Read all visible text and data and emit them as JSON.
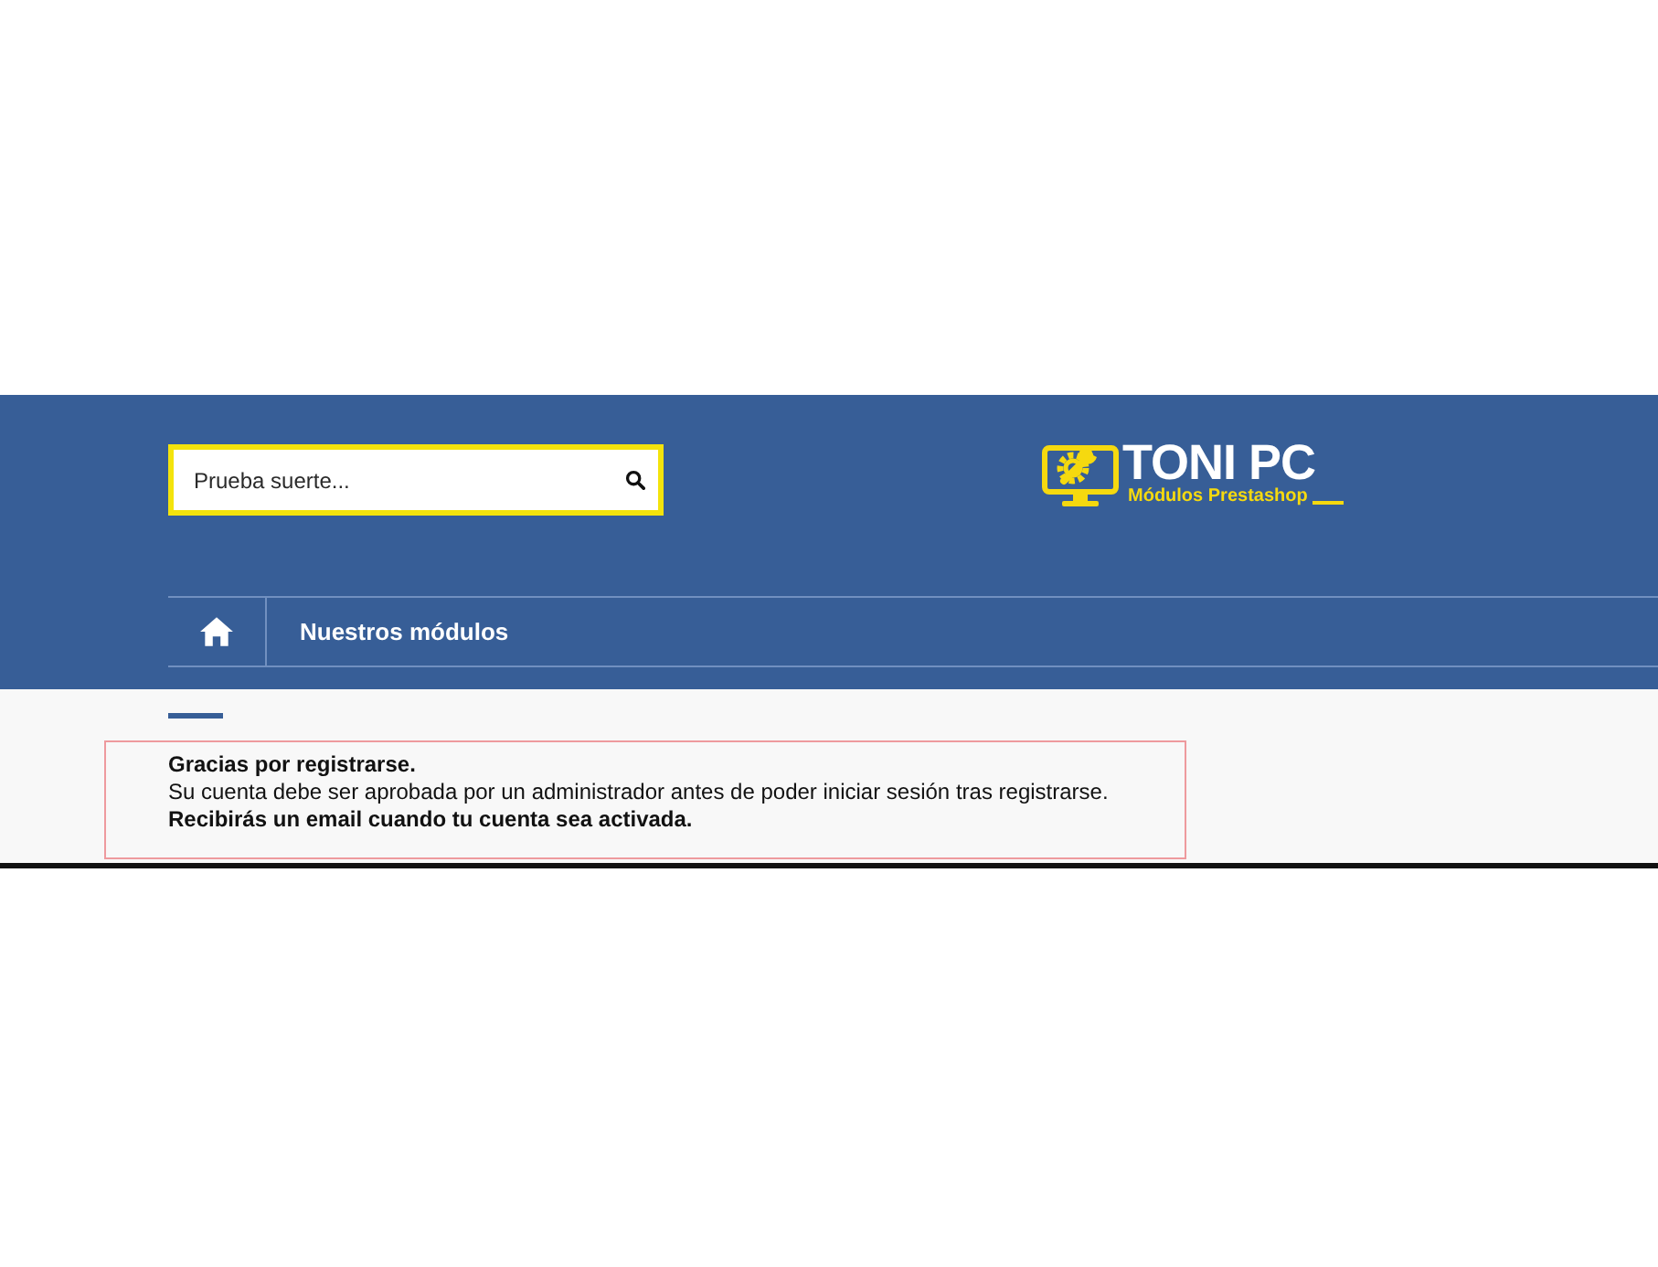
{
  "search": {
    "placeholder": "Prueba suerte..."
  },
  "logo": {
    "title": "TONI PC",
    "subtitle": "Módulos Prestashop"
  },
  "nav": {
    "items": [
      {
        "kind": "home"
      },
      {
        "kind": "link",
        "label": "Nuestros módulos"
      }
    ]
  },
  "message": {
    "lines": [
      {
        "text": "Gracias por registrarse.",
        "bold": true
      },
      {
        "text": "Su cuenta debe ser aprobada por un administrador antes de poder iniciar sesión tras registrarse.",
        "bold": false
      },
      {
        "text": "Recibirás un email cuando tu cuenta sea activada.",
        "bold": true
      }
    ]
  }
}
